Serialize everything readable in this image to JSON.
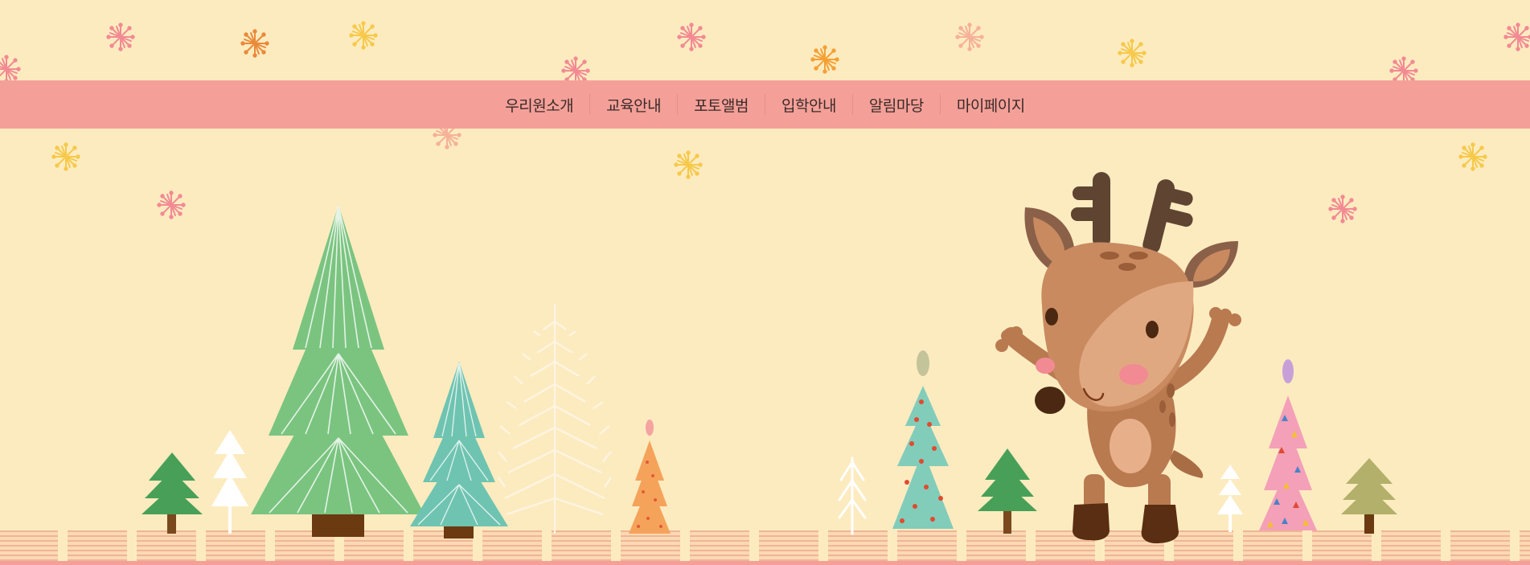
{
  "nav": {
    "items": [
      {
        "label": "우리원소개"
      },
      {
        "label": "교육안내"
      },
      {
        "label": "포토앨범"
      },
      {
        "label": "입학안내"
      },
      {
        "label": "알림마당"
      },
      {
        "label": "마이페이지"
      }
    ]
  },
  "colors": {
    "background": "#fdebc0",
    "nav_bar": "#f4a098",
    "ground_stripe": "#f0b594",
    "green_tree": "#7ac480",
    "teal_tree": "#6fc4b1",
    "deer_body": "#b97a50"
  },
  "icons": [
    "snowflake-icon",
    "pine-tree-icon",
    "deer-illustration"
  ]
}
